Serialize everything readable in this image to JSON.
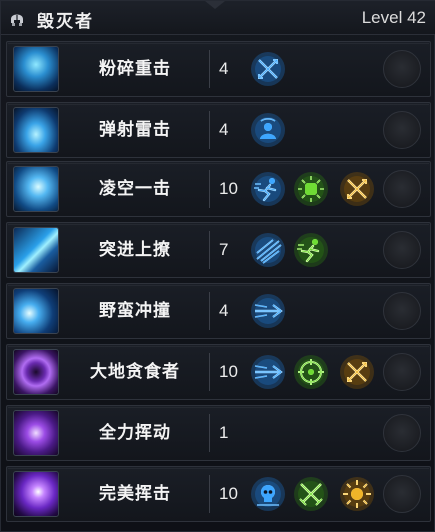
{
  "header": {
    "class_icon": "helmet-icon",
    "title": "毁灭者",
    "level_text": "Level 42"
  },
  "colors": {
    "blue_rune": "#2f8fe0",
    "green_rune": "#4ec22a",
    "gold_rune": "#e0a01e",
    "panel_bg": "#13161c"
  },
  "skills": [
    {
      "name": "粉碎重击",
      "count": "4",
      "icon": "shattering-blow-icon",
      "modifiers": [
        {
          "icon": "crossed-arrows-rune-icon",
          "color": "blue"
        }
      ]
    },
    {
      "name": "弹射雷击",
      "count": "4",
      "icon": "ricochet-lightning-icon",
      "modifiers": [
        {
          "icon": "bust-halo-rune-icon",
          "color": "blue"
        }
      ]
    },
    {
      "name": "凌空一击",
      "count": "10",
      "icon": "aerial-strike-icon",
      "modifiers": [
        {
          "icon": "dash-runner-rune-icon",
          "color": "blue"
        },
        {
          "icon": "fist-burst-rune-icon",
          "color": "green"
        },
        {
          "icon": "crossed-arrows-rune-icon",
          "color": "gold"
        }
      ]
    },
    {
      "name": "突进上撩",
      "count": "7",
      "icon": "charge-upswing-icon",
      "modifiers": [
        {
          "icon": "speed-streak-rune-icon",
          "color": "blue"
        },
        {
          "icon": "dash-runner-rune-icon",
          "color": "green"
        }
      ]
    },
    {
      "name": "野蛮冲撞",
      "count": "4",
      "icon": "savage-charge-icon",
      "modifiers": [
        {
          "icon": "piercing-arrow-rune-icon",
          "color": "blue"
        }
      ]
    },
    {
      "name": "大地贪食者",
      "count": "10",
      "icon": "earth-devourer-icon",
      "modifiers": [
        {
          "icon": "piercing-arrow-rune-icon",
          "color": "blue"
        },
        {
          "icon": "target-ring-rune-icon",
          "color": "green"
        },
        {
          "icon": "crossed-arrows-rune-icon",
          "color": "gold"
        }
      ]
    },
    {
      "name": "全力挥动",
      "count": "1",
      "icon": "full-swing-icon",
      "modifiers": []
    },
    {
      "name": "完美挥击",
      "count": "10",
      "icon": "perfect-strike-icon",
      "modifiers": [
        {
          "icon": "skull-crest-rune-icon",
          "color": "blue"
        },
        {
          "icon": "crossed-swords-rune-icon",
          "color": "green"
        },
        {
          "icon": "sun-burst-rune-icon",
          "color": "gold"
        }
      ]
    }
  ]
}
